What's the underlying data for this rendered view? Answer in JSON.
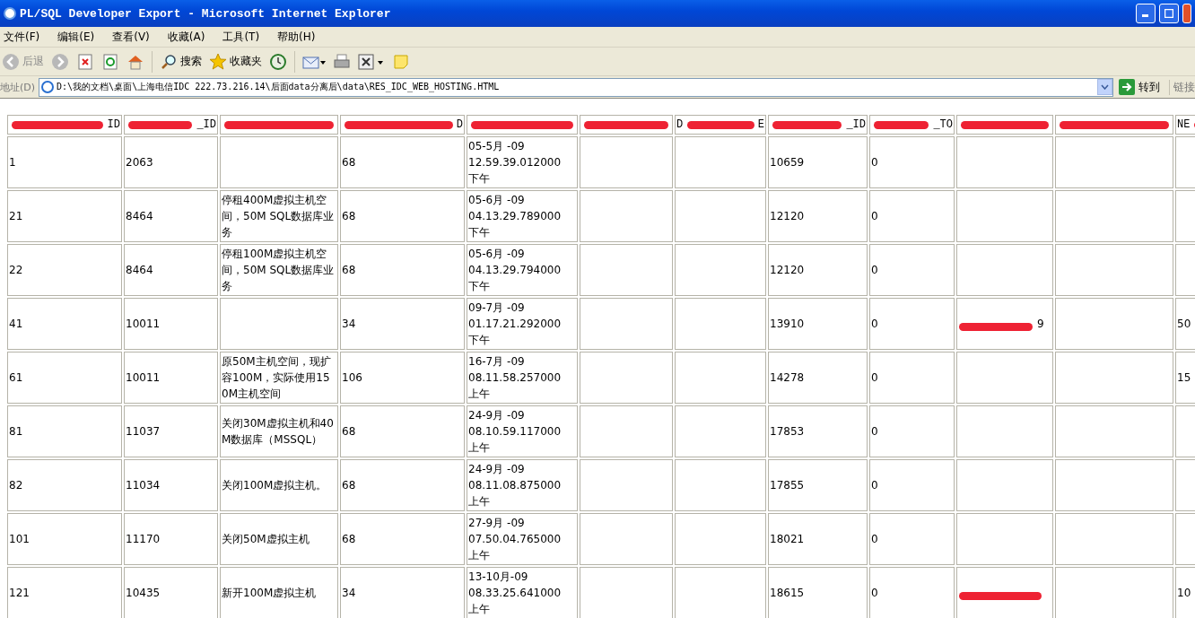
{
  "window": {
    "title": "PL/SQL Developer Export - Microsoft Internet Explorer"
  },
  "menu": [
    "文件(F)",
    "编辑(E)",
    "查看(V)",
    "收藏(A)",
    "工具(T)",
    "帮助(H)"
  ],
  "toolbar": [
    {
      "kind": "back",
      "label": "后退",
      "disabled": true
    },
    {
      "kind": "forward",
      "disabled": true
    },
    {
      "kind": "stop"
    },
    {
      "kind": "refresh"
    },
    {
      "kind": "home"
    },
    {
      "kind": "sep"
    },
    {
      "kind": "search",
      "label": "搜索"
    },
    {
      "kind": "favorites",
      "label": "收藏夹"
    },
    {
      "kind": "history"
    },
    {
      "kind": "sep"
    },
    {
      "kind": "mail"
    },
    {
      "kind": "print"
    },
    {
      "kind": "edit"
    },
    {
      "kind": "note"
    }
  ],
  "address": {
    "label": "地址(D)",
    "value": "D:\\我的文档\\桌面\\上海电信IDC 222.73.216.14\\后面data分离后\\data\\RES_IDC_WEB_HOSTING.HTML",
    "go": "转到",
    "links": "链接"
  },
  "table": {
    "columns": [
      {
        "right": "ID",
        "redacted": true
      },
      {
        "right": "_ID",
        "redacted": true
      },
      {
        "redacted": true
      },
      {
        "right": "D",
        "redacted": true
      },
      {
        "redacted": true
      },
      {
        "redacted": true
      },
      {
        "left": "D",
        "right": "E",
        "redacted": true
      },
      {
        "right": "_ID",
        "redacted": true
      },
      {
        "right": "_TO",
        "redacted": true
      },
      {
        "redacted": true
      },
      {
        "redacted": true
      },
      {
        "left": "NE",
        "redacted": true
      }
    ],
    "rows": [
      {
        "cells": [
          {
            "lines": [
              "1"
            ]
          },
          {
            "lines": [
              "2063"
            ]
          },
          {},
          {
            "lines": [
              "68"
            ]
          },
          {
            "lines": [
              "05-5月 -09",
              "12.59.39.012000",
              "下午"
            ]
          },
          {},
          {},
          {
            "lines": [
              "10659"
            ]
          },
          {
            "lines": [
              "0"
            ]
          },
          {},
          {},
          {}
        ]
      },
      {
        "cells": [
          {
            "lines": [
              "21"
            ]
          },
          {
            "lines": [
              "8464"
            ]
          },
          {
            "lines": [
              "停租400M虚拟主机空间，50M SQL数据库业务"
            ]
          },
          {
            "lines": [
              "68"
            ]
          },
          {
            "lines": [
              "05-6月 -09",
              "04.13.29.789000",
              "下午"
            ]
          },
          {},
          {},
          {
            "lines": [
              "12120"
            ]
          },
          {
            "lines": [
              "0"
            ]
          },
          {},
          {},
          {}
        ]
      },
      {
        "cells": [
          {
            "lines": [
              "22"
            ]
          },
          {
            "lines": [
              "8464"
            ]
          },
          {
            "lines": [
              "停租100M虚拟主机空间，50M SQL数据库业务"
            ]
          },
          {
            "lines": [
              "68"
            ]
          },
          {
            "lines": [
              "05-6月 -09",
              "04.13.29.794000",
              "下午"
            ]
          },
          {},
          {},
          {
            "lines": [
              "12120"
            ]
          },
          {
            "lines": [
              "0"
            ]
          },
          {},
          {},
          {}
        ]
      },
      {
        "cells": [
          {
            "lines": [
              "41"
            ]
          },
          {
            "lines": [
              "10011"
            ]
          },
          {},
          {
            "lines": [
              "34"
            ]
          },
          {
            "lines": [
              "09-7月 -09",
              "01.17.21.292000",
              "下午"
            ]
          },
          {},
          {},
          {
            "lines": [
              "13910"
            ]
          },
          {
            "lines": [
              "0"
            ]
          },
          {
            "lines": [
              "9"
            ],
            "redacted": true
          },
          {},
          {
            "lines": [
              "50"
            ]
          }
        ]
      },
      {
        "cells": [
          {
            "lines": [
              "61"
            ]
          },
          {
            "lines": [
              "10011"
            ]
          },
          {
            "lines": [
              "原50M主机空间，现扩容100M，实际使用150M主机空间"
            ]
          },
          {
            "lines": [
              "106"
            ]
          },
          {
            "lines": [
              "16-7月 -09",
              "08.11.58.257000",
              "上午"
            ]
          },
          {},
          {},
          {
            "lines": [
              "14278"
            ]
          },
          {
            "lines": [
              "0"
            ]
          },
          {},
          {},
          {
            "lines": [
              "15"
            ]
          }
        ]
      },
      {
        "cells": [
          {
            "lines": [
              "81"
            ]
          },
          {
            "lines": [
              "11037"
            ]
          },
          {
            "lines": [
              "关闭30M虚拟主机和40M数据库（MSSQL）"
            ]
          },
          {
            "lines": [
              "68"
            ]
          },
          {
            "lines": [
              "24-9月 -09",
              "08.10.59.117000",
              "上午"
            ]
          },
          {},
          {},
          {
            "lines": [
              "17853"
            ]
          },
          {
            "lines": [
              "0"
            ]
          },
          {},
          {},
          {}
        ]
      },
      {
        "cells": [
          {
            "lines": [
              "82"
            ]
          },
          {
            "lines": [
              "11034"
            ]
          },
          {
            "lines": [
              "关闭100M虚拟主机。"
            ]
          },
          {
            "lines": [
              "68"
            ]
          },
          {
            "lines": [
              "24-9月 -09",
              "08.11.08.875000",
              "上午"
            ]
          },
          {},
          {},
          {
            "lines": [
              "17855"
            ]
          },
          {
            "lines": [
              "0"
            ]
          },
          {},
          {},
          {}
        ]
      },
      {
        "cells": [
          {
            "lines": [
              "101"
            ]
          },
          {
            "lines": [
              "11170"
            ]
          },
          {
            "lines": [
              "关闭50M虚拟主机"
            ]
          },
          {
            "lines": [
              "68"
            ]
          },
          {
            "lines": [
              "27-9月 -09",
              "07.50.04.765000",
              "上午"
            ]
          },
          {},
          {},
          {
            "lines": [
              "18021"
            ]
          },
          {
            "lines": [
              "0"
            ]
          },
          {},
          {},
          {}
        ]
      },
      {
        "cells": [
          {
            "lines": [
              "121"
            ]
          },
          {
            "lines": [
              "10435"
            ]
          },
          {
            "lines": [
              "新开100M虚拟主机"
            ]
          },
          {
            "lines": [
              "34"
            ]
          },
          {
            "lines": [
              "13-10月-09",
              "08.33.25.641000",
              "上午"
            ]
          },
          {},
          {},
          {
            "lines": [
              "18615"
            ]
          },
          {
            "lines": [
              "0"
            ]
          },
          {
            "redacted": true
          },
          {},
          {
            "lines": [
              "10"
            ]
          }
        ]
      }
    ]
  }
}
